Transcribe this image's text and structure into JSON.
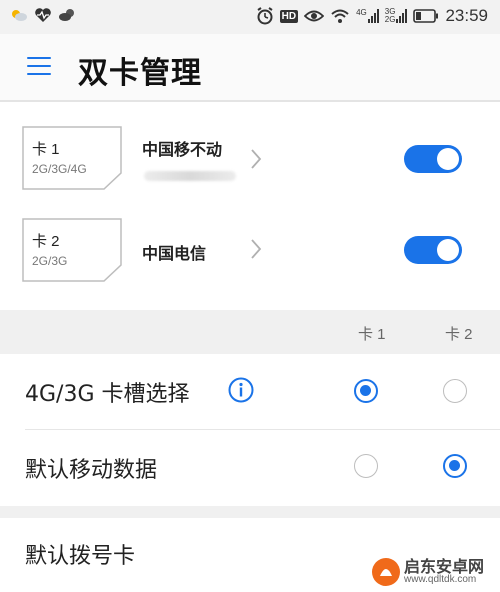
{
  "status_bar": {
    "time": "23:59",
    "hd": "HD",
    "net1_label": "4G",
    "net2_top": "3G",
    "net2_bottom": "2G"
  },
  "app_bar": {
    "title": "双卡管理",
    "menu_icon": "hamburger-menu-icon"
  },
  "sims": [
    {
      "card_label": "卡 1",
      "network": "2G/3G/4G",
      "carrier": "中国移不动",
      "enabled": true
    },
    {
      "card_label": "卡 2",
      "network": "2G/3G",
      "carrier": "中国电信",
      "enabled": true
    }
  ],
  "columns": [
    "卡 1",
    "卡 2"
  ],
  "settings": [
    {
      "label": "4G/3G 卡槽选择",
      "has_info": true,
      "selected": 1
    },
    {
      "label": "默认移动数据",
      "has_info": false,
      "selected": 2
    },
    {
      "label": "默认拨号卡"
    }
  ],
  "watermark": {
    "name": "启东安卓网",
    "url": "www.qdltdk.com"
  },
  "colors": {
    "accent": "#1a73e8"
  }
}
